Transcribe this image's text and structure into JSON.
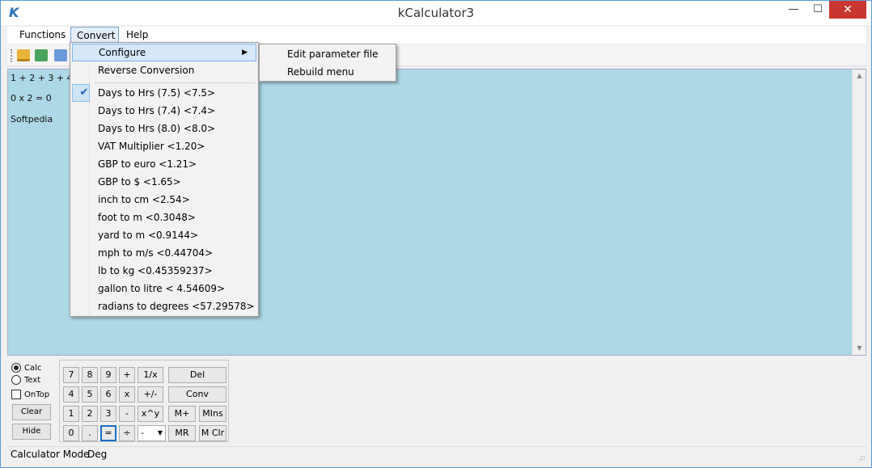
{
  "window": {
    "title": "kCalculator3",
    "app_icon": "K",
    "controls": {
      "minimize": "—",
      "maximize": "☐",
      "close": "✕"
    }
  },
  "menubar": {
    "functions": "Functions",
    "convert": "Convert",
    "help": "Help"
  },
  "toolbar": {
    "icons": [
      "folder-open-icon",
      "save-icon",
      "save-as-icon"
    ]
  },
  "textarea": {
    "lines": [
      "1 + 2 + 3 + 4 +",
      "0 x 2 = 0",
      "Softpedia"
    ],
    "background": "#add8e6",
    "scroll_up": "▲",
    "scroll_down": "▼"
  },
  "convert_menu": {
    "configure": "Configure",
    "submenu_arrow": "▶",
    "reverse": "Reverse Conversion",
    "check_mark": "✔",
    "items": [
      "Days to Hrs (7.5) <7.5>",
      "Days to Hrs (7.4) <7.4>",
      "Days to Hrs (8.0) <8.0>",
      "VAT Multiplier  <1.20>",
      "GBP to euro  <1.21>",
      "GBP to $  <1.65>",
      "inch to cm  <2.54>",
      "foot to m  <0.3048>",
      "yard to m  <0.9144>",
      "mph to m/s  <0.44704>",
      "lb to kg  <0.45359237>",
      "gallon to litre  < 4.54609>",
      "radians to degrees <57.29578>"
    ],
    "checked_index": 0
  },
  "configure_submenu": {
    "edit": "Edit parameter file",
    "rebuild": "Rebuild menu"
  },
  "mode_panel": {
    "calc": "Calc",
    "text": "Text",
    "ontop": "OnTop",
    "clear": "Clear",
    "hide": "Hide"
  },
  "keypad": {
    "row1": [
      "7",
      "8",
      "9",
      "+",
      "1/x",
      "Del"
    ],
    "row2": [
      "4",
      "5",
      "6",
      "x",
      "+/-",
      "Conv"
    ],
    "row3": [
      "1",
      "2",
      "3",
      "-",
      "x^y",
      "M+",
      "MIns"
    ],
    "row4": [
      "0",
      ".",
      "=",
      "÷",
      "MR",
      "M Clr"
    ],
    "select_value": "-",
    "select_caret": "▼"
  },
  "status": {
    "mode": "Calculator Mode",
    "angle": "Deg",
    "grip": ".:::"
  }
}
